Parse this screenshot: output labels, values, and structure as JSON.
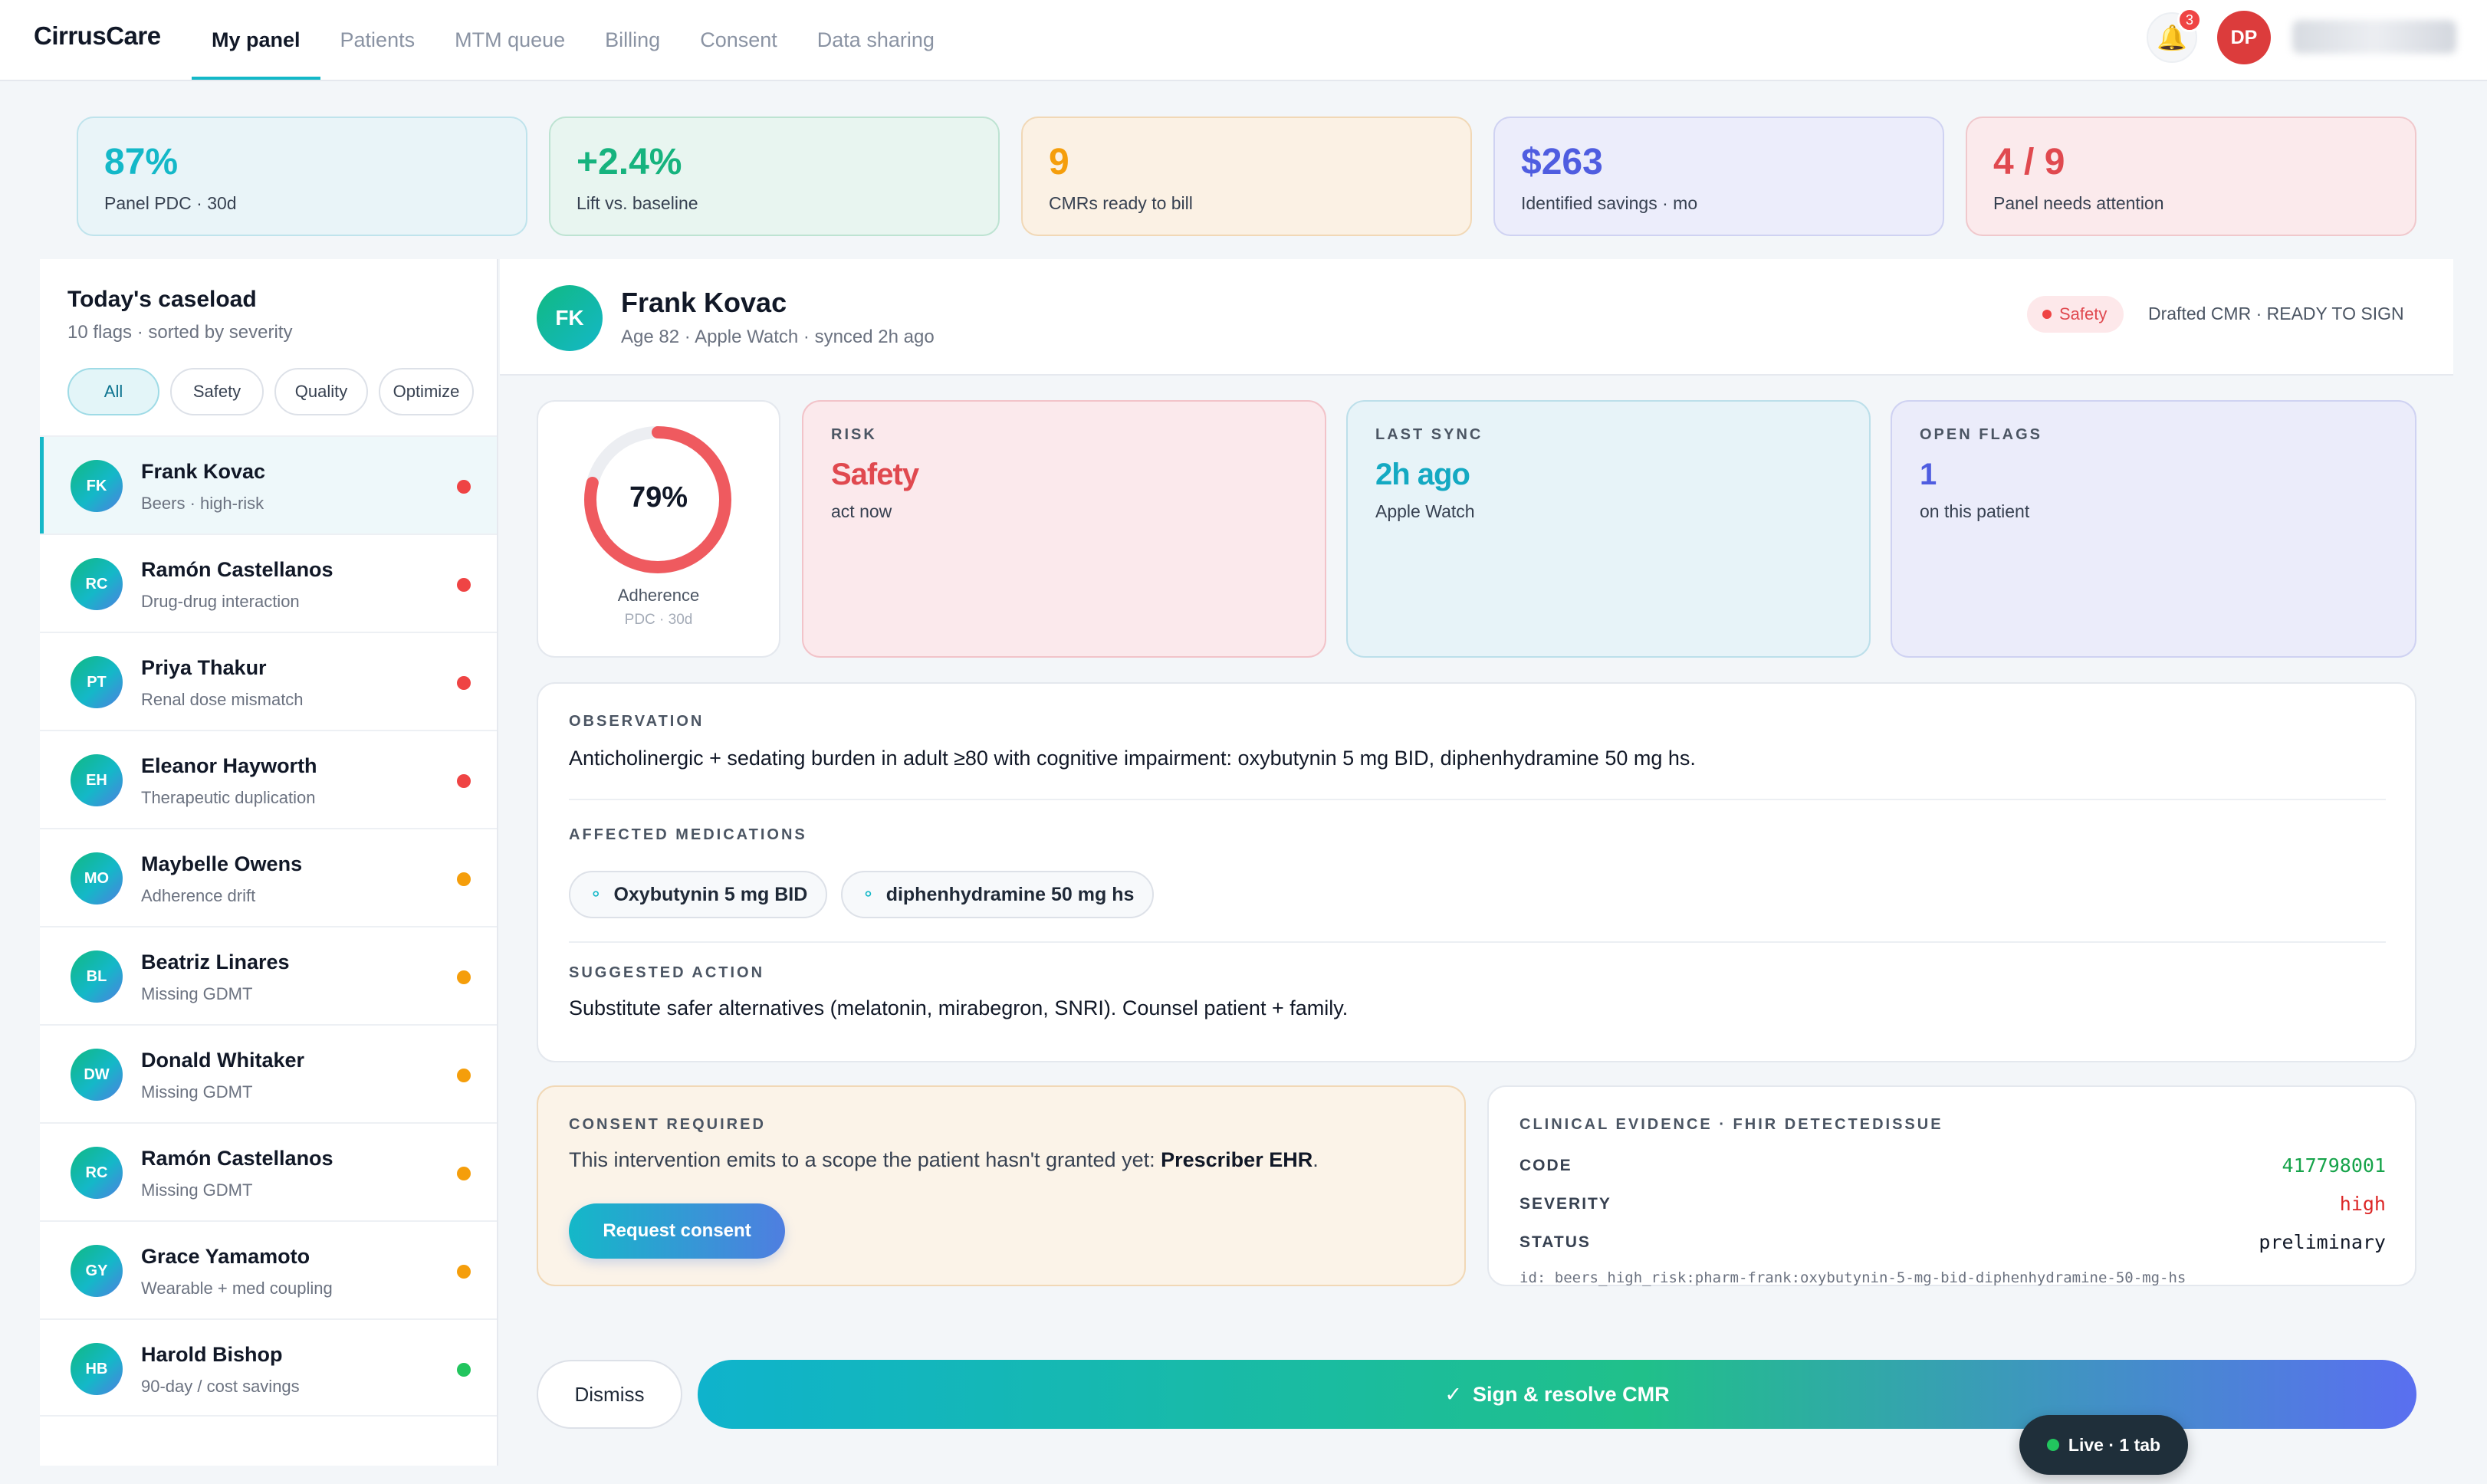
{
  "app": {
    "brand": "CirrusCare"
  },
  "nav": {
    "tabs": [
      {
        "label": "My panel",
        "active": true
      },
      {
        "label": "Patients"
      },
      {
        "label": "MTM queue"
      },
      {
        "label": "Billing"
      },
      {
        "label": "Consent"
      },
      {
        "label": "Data sharing"
      }
    ],
    "notifications_count": "3",
    "user_initials": "DP",
    "icons": {
      "bell": "bell-icon"
    }
  },
  "kpis": [
    {
      "value": "87%",
      "label": "Panel PDC · 30d",
      "color": "#14b8c8"
    },
    {
      "value": "+2.4%",
      "label": "Lift vs. baseline",
      "color": "#16b37e"
    },
    {
      "value": "9",
      "label": "CMRs ready to bill",
      "color": "#f59e0b"
    },
    {
      "value": "$263",
      "label": "Identified savings · mo",
      "color": "#4f5de0"
    },
    {
      "value": "4 / 9",
      "label": "Panel needs attention",
      "color": "#e0494f"
    }
  ],
  "caseload": {
    "title": "Today's caseload",
    "subtitle": "10 flags · sorted by severity",
    "filters": [
      "All",
      "Safety",
      "Quality",
      "Optimize"
    ],
    "active_filter": "All",
    "patients": [
      {
        "initials": "FK",
        "name": "Frank Kovac",
        "desc": "Beers · high-risk",
        "severity": "red",
        "selected": true
      },
      {
        "initials": "RC",
        "name": "Ramón Castellanos",
        "desc": "Drug-drug interaction",
        "severity": "red"
      },
      {
        "initials": "PT",
        "name": "Priya Thakur",
        "desc": "Renal dose mismatch",
        "severity": "red"
      },
      {
        "initials": "EH",
        "name": "Eleanor Hayworth",
        "desc": "Therapeutic duplication",
        "severity": "red"
      },
      {
        "initials": "MO",
        "name": "Maybelle Owens",
        "desc": "Adherence drift",
        "severity": "orange"
      },
      {
        "initials": "BL",
        "name": "Beatriz Linares",
        "desc": "Missing GDMT",
        "severity": "orange"
      },
      {
        "initials": "DW",
        "name": "Donald Whitaker",
        "desc": "Missing GDMT",
        "severity": "orange"
      },
      {
        "initials": "RC",
        "name": "Ramón Castellanos",
        "desc": "Missing GDMT",
        "severity": "orange"
      },
      {
        "initials": "GY",
        "name": "Grace Yamamoto",
        "desc": "Wearable + med coupling",
        "severity": "orange"
      },
      {
        "initials": "HB",
        "name": "Harold Bishop",
        "desc": "90-day / cost savings",
        "severity": "green"
      }
    ],
    "severity_colors": {
      "red": "#ef4444",
      "orange": "#f59e0b",
      "green": "#22c55e"
    }
  },
  "patient": {
    "initials": "FK",
    "name": "Frank Kovac",
    "meta": "Age 82 · Apple Watch · synced 2h ago",
    "badge": "Safety",
    "status": "Drafted CMR · READY TO SIGN"
  },
  "adherence": {
    "value": 0.79,
    "value_label": "79%",
    "label": "Adherence",
    "sublabel": "PDC · 30d"
  },
  "stats": {
    "risk": {
      "caption": "RISK",
      "value": "Safety",
      "sub": "act now"
    },
    "sync": {
      "caption": "LAST SYNC",
      "value": "2h ago",
      "sub": "Apple Watch"
    },
    "flags": {
      "caption": "OPEN FLAGS",
      "value": "1",
      "sub": "on this patient"
    }
  },
  "observation": {
    "caption": "OBSERVATION",
    "text": "Anticholinergic + sedating burden in adult ≥80 with cognitive impairment: oxybutynin 5 mg BID, diphenhydramine 50 mg hs.",
    "meds_caption": "AFFECTED MEDICATIONS",
    "meds": [
      "Oxybutynin 5 mg BID",
      "diphenhydramine 50 mg hs"
    ],
    "action_caption": "SUGGESTED ACTION",
    "action_text": "Substitute safer alternatives (melatonin, mirabegron, SNRI). Counsel patient + family."
  },
  "consent": {
    "caption": "CONSENT REQUIRED",
    "text_prefix": "This intervention emits to a scope the patient hasn't granted yet: ",
    "scope": "Prescriber EHR",
    "text_suffix": ".",
    "button": "Request consent"
  },
  "evidence": {
    "caption": "CLINICAL EVIDENCE · FHIR DETECTEDISSUE",
    "rows": [
      {
        "key": "CODE",
        "value": "417798001",
        "color": "#16a34a"
      },
      {
        "key": "SEVERITY",
        "value": "high",
        "color": "#dc2626"
      },
      {
        "key": "STATUS",
        "value": "preliminary",
        "color": "#111827"
      }
    ],
    "id": "id: beers_high_risk:pharm-frank:oxybutynin-5-mg-bid-diphenhydramine-50-mg-hs"
  },
  "actions": {
    "dismiss": "Dismiss",
    "sign": "Sign & resolve CMR"
  },
  "live": {
    "label": "Live · 1 tab"
  }
}
